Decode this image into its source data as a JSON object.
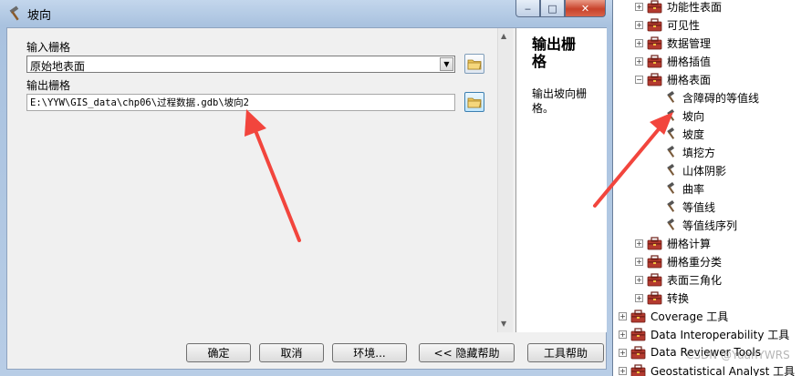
{
  "dialog": {
    "title": "坡向",
    "title_icon": "hammer-icon",
    "controls": {
      "minimize": "‒",
      "maximize": "□",
      "close": "✕"
    }
  },
  "form": {
    "input_raster": {
      "label": "输入栅格",
      "value": "原始地表面"
    },
    "output_raster": {
      "label": "输出栅格",
      "value": "E:\\YYW\\GIS_data\\chp06\\过程数据.gdb\\坡向2"
    }
  },
  "help": {
    "title": "输出栅格",
    "text": "输出坡向栅格。"
  },
  "buttons": {
    "ok": "确定",
    "cancel": "取消",
    "env": "环境...",
    "hide_help": "<< 隐藏帮助",
    "tool_help": "工具帮助"
  },
  "tree": {
    "items": [
      {
        "label": "功能性表面",
        "kind": "toolset",
        "pm": "+"
      },
      {
        "label": "可见性",
        "kind": "toolset",
        "pm": "+"
      },
      {
        "label": "数据管理",
        "kind": "toolset",
        "pm": "+"
      },
      {
        "label": "栅格插值",
        "kind": "toolset",
        "pm": "+"
      },
      {
        "label": "栅格表面",
        "kind": "toolset",
        "pm": "−"
      },
      {
        "label": "含障碍的等值线",
        "kind": "tool"
      },
      {
        "label": "坡向",
        "kind": "tool",
        "selected": true
      },
      {
        "label": "坡度",
        "kind": "tool"
      },
      {
        "label": "填挖方",
        "kind": "tool"
      },
      {
        "label": "山体阴影",
        "kind": "tool"
      },
      {
        "label": "曲率",
        "kind": "tool"
      },
      {
        "label": "等值线",
        "kind": "tool"
      },
      {
        "label": "等值线序列",
        "kind": "tool"
      },
      {
        "label": "栅格计算",
        "kind": "toolset",
        "pm": "+"
      },
      {
        "label": "栅格重分类",
        "kind": "toolset",
        "pm": "+"
      },
      {
        "label": "表面三角化",
        "kind": "toolset",
        "pm": "+"
      },
      {
        "label": "转换",
        "kind": "toolset",
        "pm": "+"
      },
      {
        "label": "Coverage 工具",
        "kind": "toolbox",
        "pm": "+"
      },
      {
        "label": "Data Interoperability 工具",
        "kind": "toolbox",
        "pm": "+"
      },
      {
        "label": "Data Reviewer Tools",
        "kind": "toolbox",
        "pm": "+"
      },
      {
        "label": "Geostatistical Analyst 工具",
        "kind": "toolbox",
        "pm": "+"
      }
    ]
  },
  "watermark": "CSDN @YuanYWRS",
  "colors": {
    "arrow": "#f2453d",
    "titlebar": "#b9cde5",
    "close": "#c8432b"
  }
}
